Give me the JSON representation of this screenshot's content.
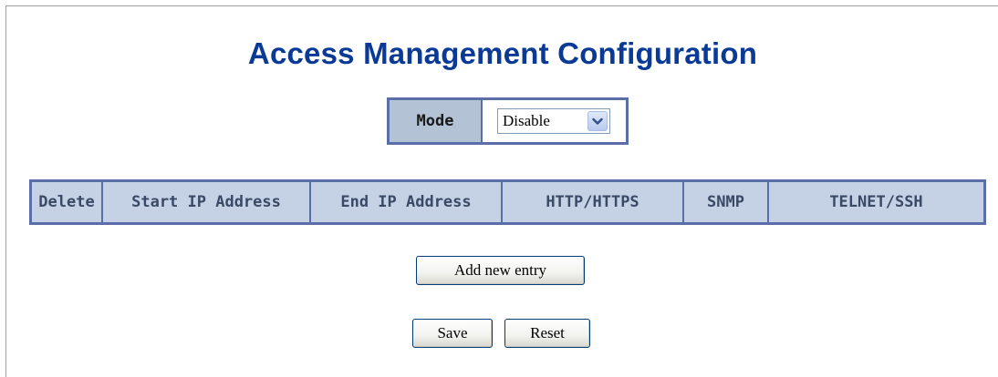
{
  "page": {
    "title": "Access Management Configuration"
  },
  "mode": {
    "label": "Mode",
    "selected": "Disable"
  },
  "entries_table": {
    "columns": [
      "Delete",
      "Start IP Address",
      "End IP Address",
      "HTTP/HTTPS",
      "SNMP",
      "TELNET/SSH"
    ]
  },
  "actions": {
    "add_label": "Add new entry",
    "save_label": "Save",
    "reset_label": "Reset"
  },
  "colors": {
    "title": "#0a3a96",
    "table_border": "#5a6fa8",
    "header_bg": "#c5d1e4",
    "mode_label_bg": "#b4c2d6"
  },
  "icons": {
    "dropdown": "chevron-down-icon"
  }
}
